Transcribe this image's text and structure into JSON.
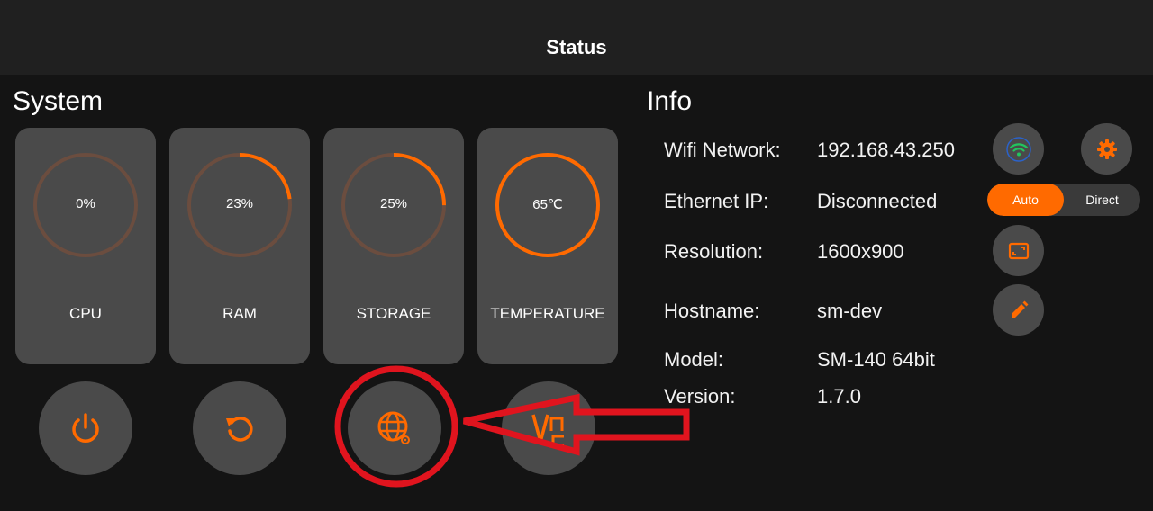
{
  "header": {
    "title": "Status"
  },
  "system": {
    "title": "System",
    "gauges": [
      {
        "label": "CPU",
        "value_text": "0%",
        "fraction": 0.0
      },
      {
        "label": "RAM",
        "value_text": "23%",
        "fraction": 0.23
      },
      {
        "label": "STORAGE",
        "value_text": "25%",
        "fraction": 0.25
      },
      {
        "label": "TEMPERATURE",
        "value_text": "65℃",
        "fraction": 1.0
      }
    ],
    "actions": [
      {
        "name": "power-button",
        "icon": "power-icon"
      },
      {
        "name": "restart-button",
        "icon": "restart-icon"
      },
      {
        "name": "network-settings-button",
        "icon": "globe-gear-icon"
      },
      {
        "name": "vnc-button",
        "icon": "vnc-icon"
      }
    ]
  },
  "info": {
    "title": "Info",
    "rows": [
      {
        "label": "Wifi Network:",
        "value": "192.168.43.250"
      },
      {
        "label": "Ethernet IP:",
        "value": "Disconnected"
      },
      {
        "label": "Resolution:",
        "value": "1600x900"
      },
      {
        "label": "Hostname:",
        "value": "sm-dev"
      },
      {
        "label": "Model:",
        "value": "SM-140 64bit"
      },
      {
        "label": "Version:",
        "value": "1.7.0"
      }
    ],
    "ethernet_toggle": {
      "options": [
        "Auto",
        "Direct"
      ],
      "selected": "Auto"
    }
  },
  "colors": {
    "accent": "#ff6a00",
    "track": "#6b4d3f",
    "card": "#4a4a4a",
    "wifi": "#22c55e",
    "annotation": "#e0141e"
  }
}
